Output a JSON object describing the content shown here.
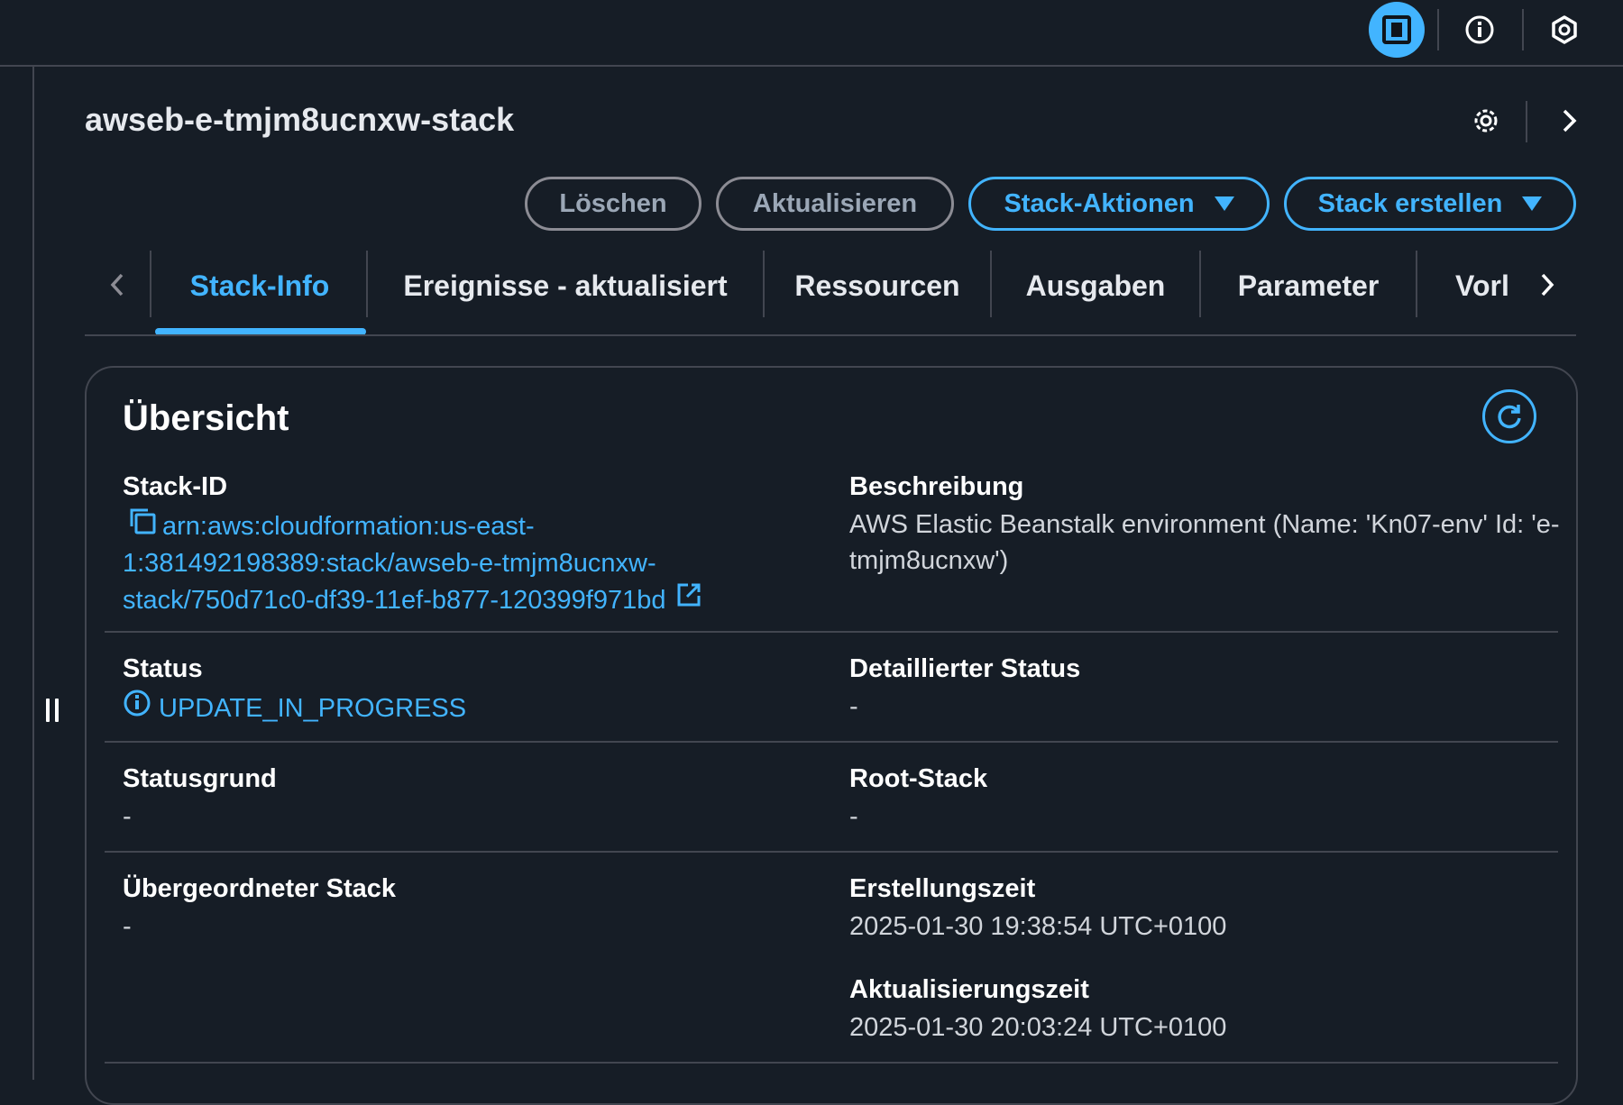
{
  "topbar": {
    "icons": [
      "panel-toggle-icon",
      "info-icon",
      "hexagon-settings-icon"
    ]
  },
  "header": {
    "title": "awseb-e-tmjm8ucnxw-stack",
    "icons": [
      "gear-icon",
      "chevron-right-icon"
    ]
  },
  "actions": {
    "delete_label": "Löschen",
    "update_label": "Aktualisieren",
    "stack_actions_label": "Stack-Aktionen",
    "create_stack_label": "Stack erstellen"
  },
  "tabs": [
    {
      "label": "Stack-Info",
      "active": true
    },
    {
      "label": "Ereignisse - aktualisiert",
      "active": false
    },
    {
      "label": "Ressourcen",
      "active": false
    },
    {
      "label": "Ausgaben",
      "active": false
    },
    {
      "label": "Parameter",
      "active": false
    },
    {
      "label": "Vorl",
      "active": false
    }
  ],
  "overview": {
    "title": "Übersicht",
    "stack_id": {
      "label": "Stack-ID",
      "line1": "arn:aws:cloudformation:us-east-",
      "line2": "1:381492198389:stack/awseb-e-tmjm8ucnxw-",
      "line3": "stack/750d71c0-df39-11ef-b877-120399f971bd"
    },
    "description": {
      "label": "Beschreibung",
      "line1": "AWS Elastic Beanstalk environment (Name: 'Kn07-env' Id: 'e-",
      "line2": "tmjm8ucnxw')"
    },
    "status": {
      "label": "Status",
      "value": "UPDATE_IN_PROGRESS"
    },
    "detailed_status": {
      "label": "Detaillierter Status",
      "value": "-"
    },
    "status_reason": {
      "label": "Statusgrund",
      "value": "-"
    },
    "root_stack": {
      "label": "Root-Stack",
      "value": "-"
    },
    "parent_stack": {
      "label": "Übergeordneter Stack",
      "value": "-"
    },
    "creation_time": {
      "label": "Erstellungszeit",
      "value": "2025-01-30 19:38:54 UTC+0100"
    },
    "update_time": {
      "label": "Aktualisierungszeit",
      "value": "2025-01-30 20:03:24 UTC+0100"
    }
  },
  "colors": {
    "accent": "#42b4ff",
    "background": "#161d26",
    "border": "#424650"
  }
}
